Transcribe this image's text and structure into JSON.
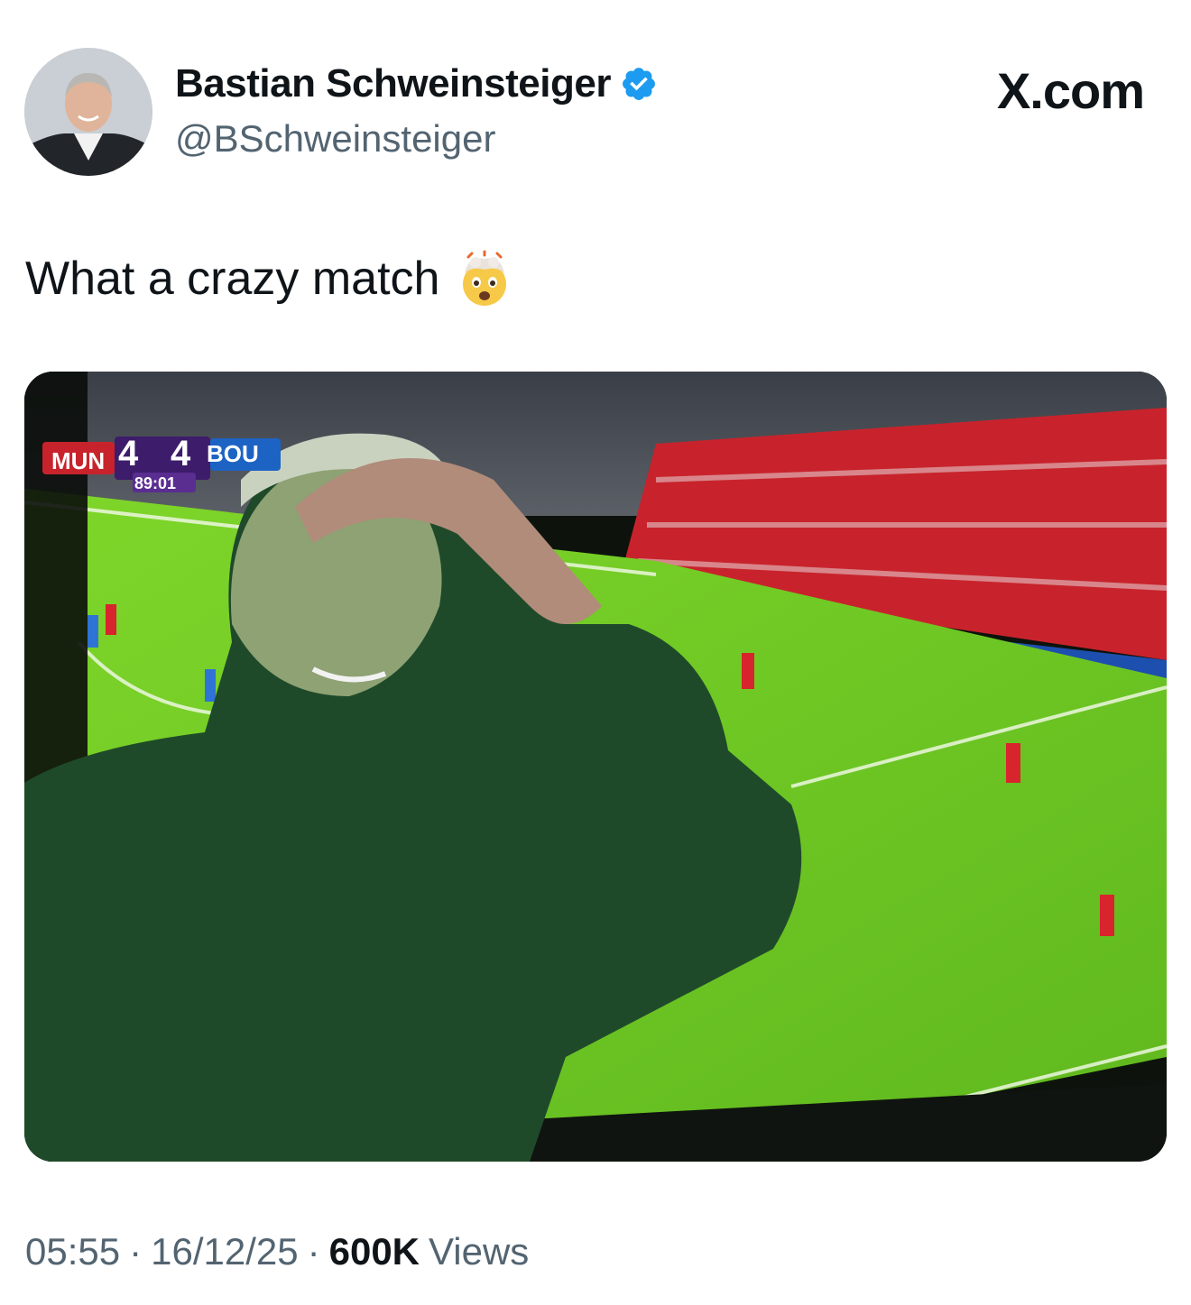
{
  "brand": {
    "label": "X.com"
  },
  "author": {
    "display_name": "Bastian Schweinsteiger",
    "handle": "@BSchweinsteiger",
    "verified": true,
    "verified_icon": "verified-badge-icon",
    "verified_color": "#1d9bf0"
  },
  "tweet": {
    "text": "What a crazy match",
    "emoji": "exploding-head-emoji"
  },
  "media": {
    "scoreboard": {
      "home": "MUN",
      "home_score": "4",
      "away_score": "4",
      "away": "BOU",
      "clock": "89:01"
    }
  },
  "meta": {
    "time": "05:55",
    "separator": "·",
    "date": "16/12/25",
    "views_count": "600K",
    "views_label": "Views"
  },
  "colors": {
    "text_primary": "#0f1419",
    "text_secondary": "#536471",
    "accent": "#1d9bf0"
  }
}
